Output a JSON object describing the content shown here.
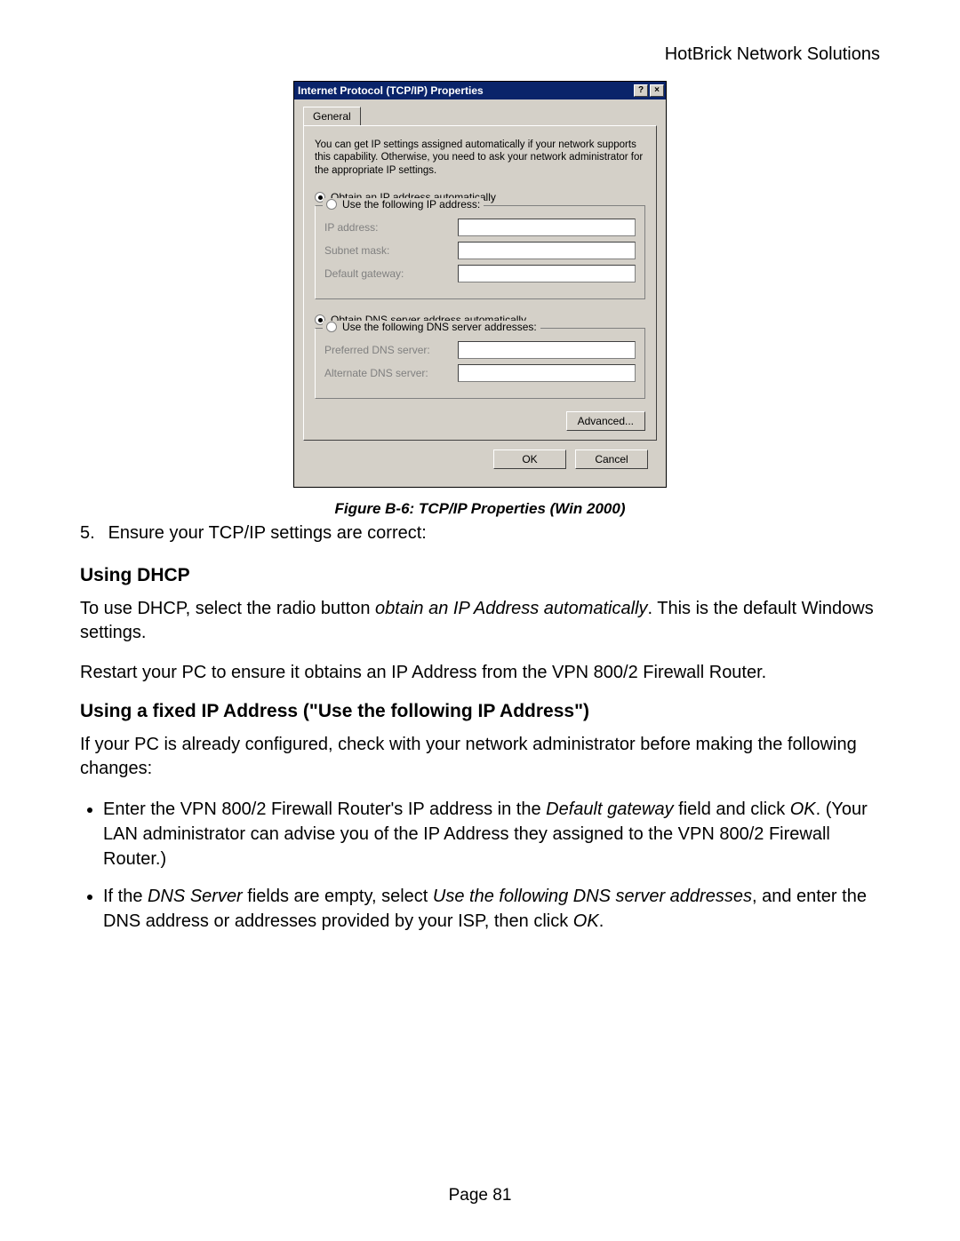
{
  "header": {
    "brand": "HotBrick Network Solutions"
  },
  "dialog": {
    "title": "Internet Protocol (TCP/IP) Properties",
    "help_glyph": "?",
    "close_glyph": "×",
    "tab_label": "General",
    "description": "You can get IP settings assigned automatically if your network supports this capability. Otherwise, you need to ask your network administrator for the appropriate IP settings.",
    "ip_group": {
      "auto_label": "Obtain an IP address automatically",
      "manual_label": "Use the following IP address:",
      "fields": {
        "ip": "IP address:",
        "subnet": "Subnet mask:",
        "gateway": "Default gateway:"
      }
    },
    "dns_group": {
      "auto_label": "Obtain DNS server address automatically",
      "manual_label": "Use the following DNS server addresses:",
      "fields": {
        "preferred": "Preferred DNS server:",
        "alternate": "Alternate DNS server:"
      }
    },
    "buttons": {
      "advanced": "Advanced...",
      "ok": "OK",
      "cancel": "Cancel"
    }
  },
  "figure_caption": "Figure B-6: TCP/IP Properties (Win 2000)",
  "step5": {
    "num": "5.",
    "text": "Ensure your TCP/IP settings are correct:"
  },
  "dhcp": {
    "heading": "Using DHCP",
    "p1_a": "To use DHCP, select the radio button ",
    "p1_i": "obtain an IP Address automatically",
    "p1_b": ". This is the default Windows settings.",
    "p2": "Restart your PC to ensure it obtains an IP Address from the VPN 800/2 Firewall Router."
  },
  "fixed": {
    "heading": "Using a fixed IP Address (\"Use the following IP Address\")",
    "intro": "If your PC is already configured, check with your network administrator before making the following changes:",
    "b1_a": "Enter the VPN 800/2 Firewall Router's IP address in the ",
    "b1_i1": "Default gateway",
    "b1_b": " field and click ",
    "b1_i2": "OK",
    "b1_c": ". (Your LAN administrator can advise you of the IP Address they assigned to the VPN 800/2 Firewall Router.)",
    "b2_a": "If the ",
    "b2_i1": "DNS Server",
    "b2_b": " fields are empty, select ",
    "b2_i2": "Use the following DNS server addresses",
    "b2_c": ", and enter the DNS address or addresses provided by your ISP, then click ",
    "b2_i3": "OK",
    "b2_d": "."
  },
  "page_number": "Page 81"
}
